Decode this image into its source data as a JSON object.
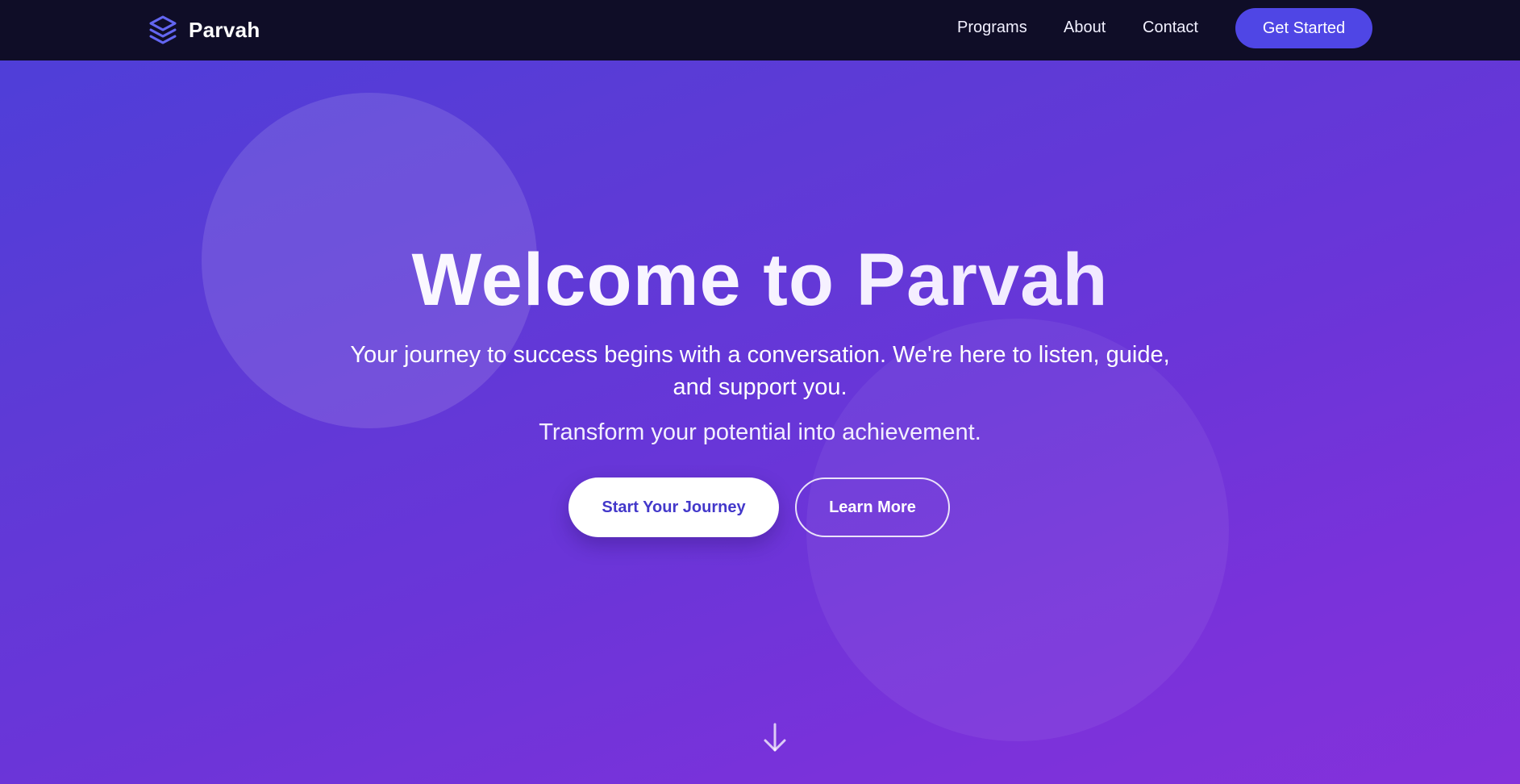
{
  "navbar": {
    "brand_name": "Parvah",
    "logo_icon": "layers-icon",
    "links": [
      "Programs",
      "About",
      "Contact"
    ],
    "cta_label": "Get Started"
  },
  "hero": {
    "title": "Welcome to Parvah",
    "subtitle": "Your journey to success begins with a conversation. We're here to listen, guide, and support you.",
    "tagline": "Transform your potential into achievement.",
    "primary_button": "Start Your Journey",
    "secondary_button": "Learn More",
    "scroll_icon": "arrow-down-icon"
  },
  "colors": {
    "navbar_bg": "#0f0d27",
    "accent": "#4f46e5",
    "gradient_start": "#4f3ed8",
    "gradient_end": "#8431db",
    "primary_button_text": "#4338ca"
  }
}
